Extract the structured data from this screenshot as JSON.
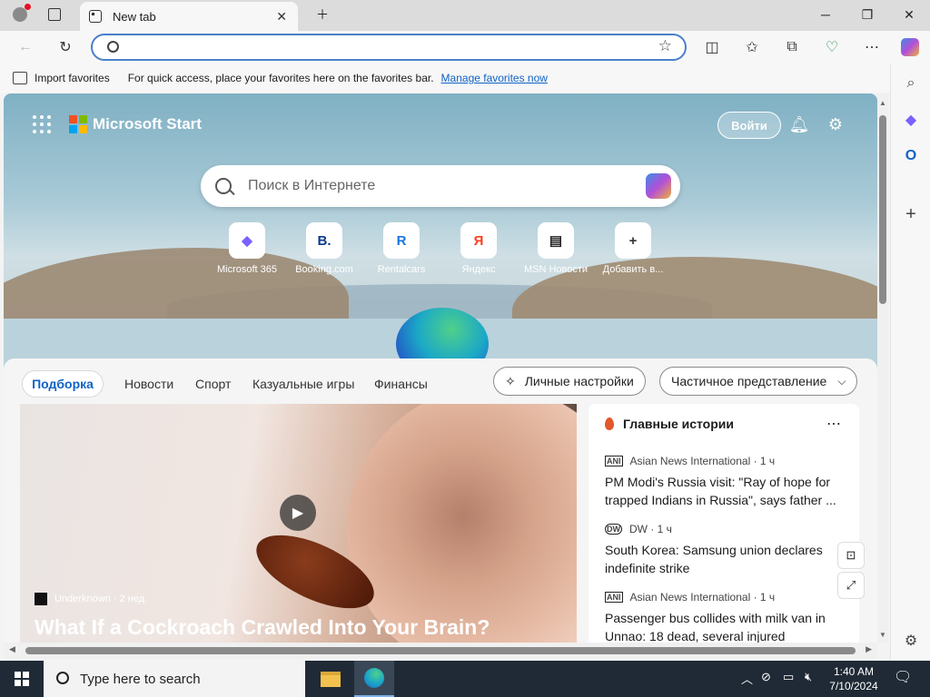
{
  "browser": {
    "tab_title": "New tab",
    "address_value": "",
    "favorites_bar": {
      "import_label": "Import favorites",
      "hint": "For quick access, place your favorites here on the favorites bar.",
      "manage_link": "Manage favorites now"
    }
  },
  "newtab": {
    "brand": "Microsoft Start",
    "login_label": "Войти",
    "search_placeholder": "Поиск в Интернете",
    "quick_links": [
      {
        "label": "Microsoft 365",
        "icon": "microsoft-365-icon",
        "glyph": "◆",
        "color": "#7b61ff"
      },
      {
        "label": "Booking.com",
        "icon": "booking-icon",
        "glyph": "B.",
        "color": "#0c3b8c"
      },
      {
        "label": "Rentalcars",
        "icon": "rentalcars-icon",
        "glyph": "R",
        "color": "#1a73e8"
      },
      {
        "label": "Яндекс",
        "icon": "yandex-icon",
        "glyph": "Я",
        "color": "#fc3f1d"
      },
      {
        "label": "MSN Новости",
        "icon": "msn-news-icon",
        "glyph": "▤",
        "color": "#222222"
      },
      {
        "label": "Добавить в...",
        "icon": "add-icon",
        "glyph": "+",
        "color": "#333333"
      }
    ],
    "feed_tabs": [
      "Подборка",
      "Новости",
      "Спорт",
      "Казуальные игры",
      "Финансы"
    ],
    "personalize_label": "Личные настройки",
    "view_label": "Частичное представление",
    "hero": {
      "source": "Underknown · 2 нед.",
      "title": "What If a Cockroach Crawled Into Your Brain?"
    },
    "top_stories": {
      "heading": "Главные истории",
      "items": [
        {
          "source_logo": "ANI",
          "source": "Asian News International · 1 ч",
          "title": "PM Modi's Russia visit: \"Ray of hope for trapped Indians in Russia\", says father ..."
        },
        {
          "source_logo": "DW",
          "source": "DW · 1 ч",
          "title": "South Korea: Samsung union declares indefinite strike"
        },
        {
          "source_logo": "ANI",
          "source": "Asian News International · 1 ч",
          "title": "Passenger bus collides with milk van in Unnao: 18 dead, several injured"
        }
      ]
    }
  },
  "taskbar": {
    "search_placeholder": "Type here to search",
    "time": "1:40 AM",
    "date": "7/10/2024"
  },
  "colors": {
    "accent": "#0f62c7",
    "taskbar": "#1f2a36",
    "ms_red": "#f25022",
    "ms_green": "#7fba00",
    "ms_blue": "#00a4ef",
    "ms_yellow": "#ffb900"
  }
}
